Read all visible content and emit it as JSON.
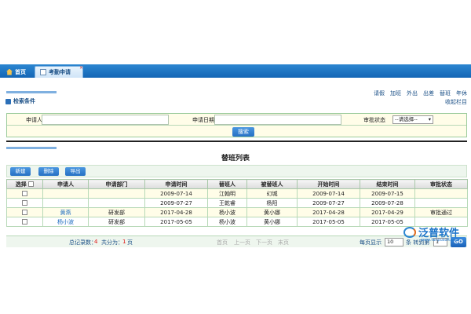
{
  "tabs": [
    {
      "label": "首页",
      "icon": "home-icon"
    },
    {
      "label": "考勤申请",
      "icon": "document-icon"
    }
  ],
  "top_links": [
    "请假",
    "加班",
    "外出",
    "出差",
    "替班",
    "年休"
  ],
  "collapse_label": "收起栏目",
  "search": {
    "title": "检索条件",
    "applicant_label": "申请人",
    "date_label": "申请日期",
    "status_label": "审批状态",
    "status_value": "--请选择--",
    "button": "搜索"
  },
  "list": {
    "title": "替班列表",
    "buttons": [
      "新建",
      "删除",
      "导出"
    ],
    "columns": [
      "选择",
      "申请人",
      "申请部门",
      "申请时间",
      "替班人",
      "被替班人",
      "开始时间",
      "结束时间",
      "审批状态"
    ],
    "rows": [
      [
        "",
        "",
        "",
        "2009-07-14",
        "江翰明",
        "幻城",
        "2009-07-14",
        "2009-07-15",
        ""
      ],
      [
        "",
        "",
        "",
        "2009-07-27",
        "王乾睿",
        "杨阳",
        "2009-07-27",
        "2009-07-28",
        ""
      ],
      [
        "",
        "黄燕",
        "研发部",
        "2017-04-28",
        "杨小波",
        "黄小娜",
        "2017-04-28",
        "2017-04-29",
        "审批通过"
      ],
      [
        "",
        "杨小波",
        "研发部",
        "2017-05-05",
        "杨小波",
        "黄小娜",
        "2017-05-05",
        "2017-05-05",
        ""
      ]
    ]
  },
  "pager": {
    "total_label": "总记录数：",
    "total": "4",
    "pages_label": "共分为：",
    "pages": "1",
    "pages_unit": "页",
    "first": "首页",
    "prev": "上一页",
    "next": "下一页",
    "last": "末页",
    "per_page_label": "每页显示",
    "per_page": "10",
    "goto_label": "条 转到第",
    "goto_page": "1",
    "go": "GO"
  },
  "watermark": {
    "text": "泛普软件",
    "sub": "www.fanpusoft.com"
  }
}
